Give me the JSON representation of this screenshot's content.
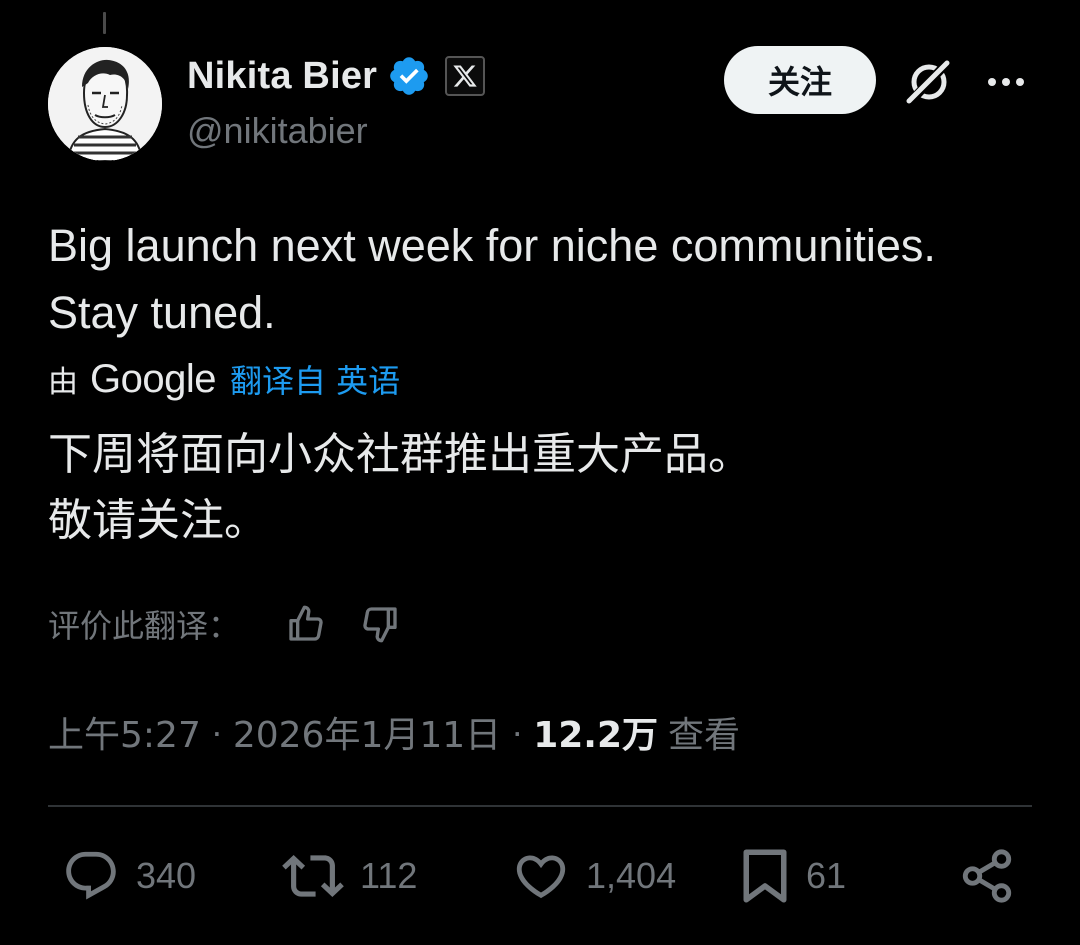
{
  "tweet": {
    "author": {
      "display_name": "Nikita Bier",
      "handle": "@nikitabier",
      "verified": true,
      "affiliation_badge": "x-logo-icon"
    },
    "follow_label": "关注",
    "text_lines": [
      "Big launch next week for niche communities.",
      "Stay tuned."
    ],
    "translation": {
      "by_label": "由",
      "provider": "Google",
      "link_label": "翻译自 英语",
      "text_lines": [
        "下周将面向小众社群推出重大产品。",
        "敬请关注。"
      ],
      "rate_label": "评价此翻译："
    },
    "meta": {
      "time": "上午5:27",
      "separator": "·",
      "date": "2026年1月11日",
      "views_count": "12.2万",
      "views_label": "查看"
    },
    "actions": {
      "replies": "340",
      "retweets": "112",
      "likes": "1,404",
      "bookmarks": "61"
    }
  },
  "colors": {
    "background": "#000000",
    "text_primary": "#e7e9ea",
    "text_secondary": "#71767b",
    "link": "#1d9bf0",
    "verified": "#1d9bf0",
    "divider": "#2f3336",
    "follow_button_bg": "#eff3f4"
  },
  "icons": {
    "verified": "verified-badge-icon",
    "grok": "grok-icon",
    "more": "more-options-icon",
    "thumbs_up": "thumbs-up-icon",
    "thumbs_down": "thumbs-down-icon",
    "reply": "reply-icon",
    "retweet": "retweet-icon",
    "like": "heart-icon",
    "bookmark": "bookmark-icon",
    "share": "share-icon"
  }
}
